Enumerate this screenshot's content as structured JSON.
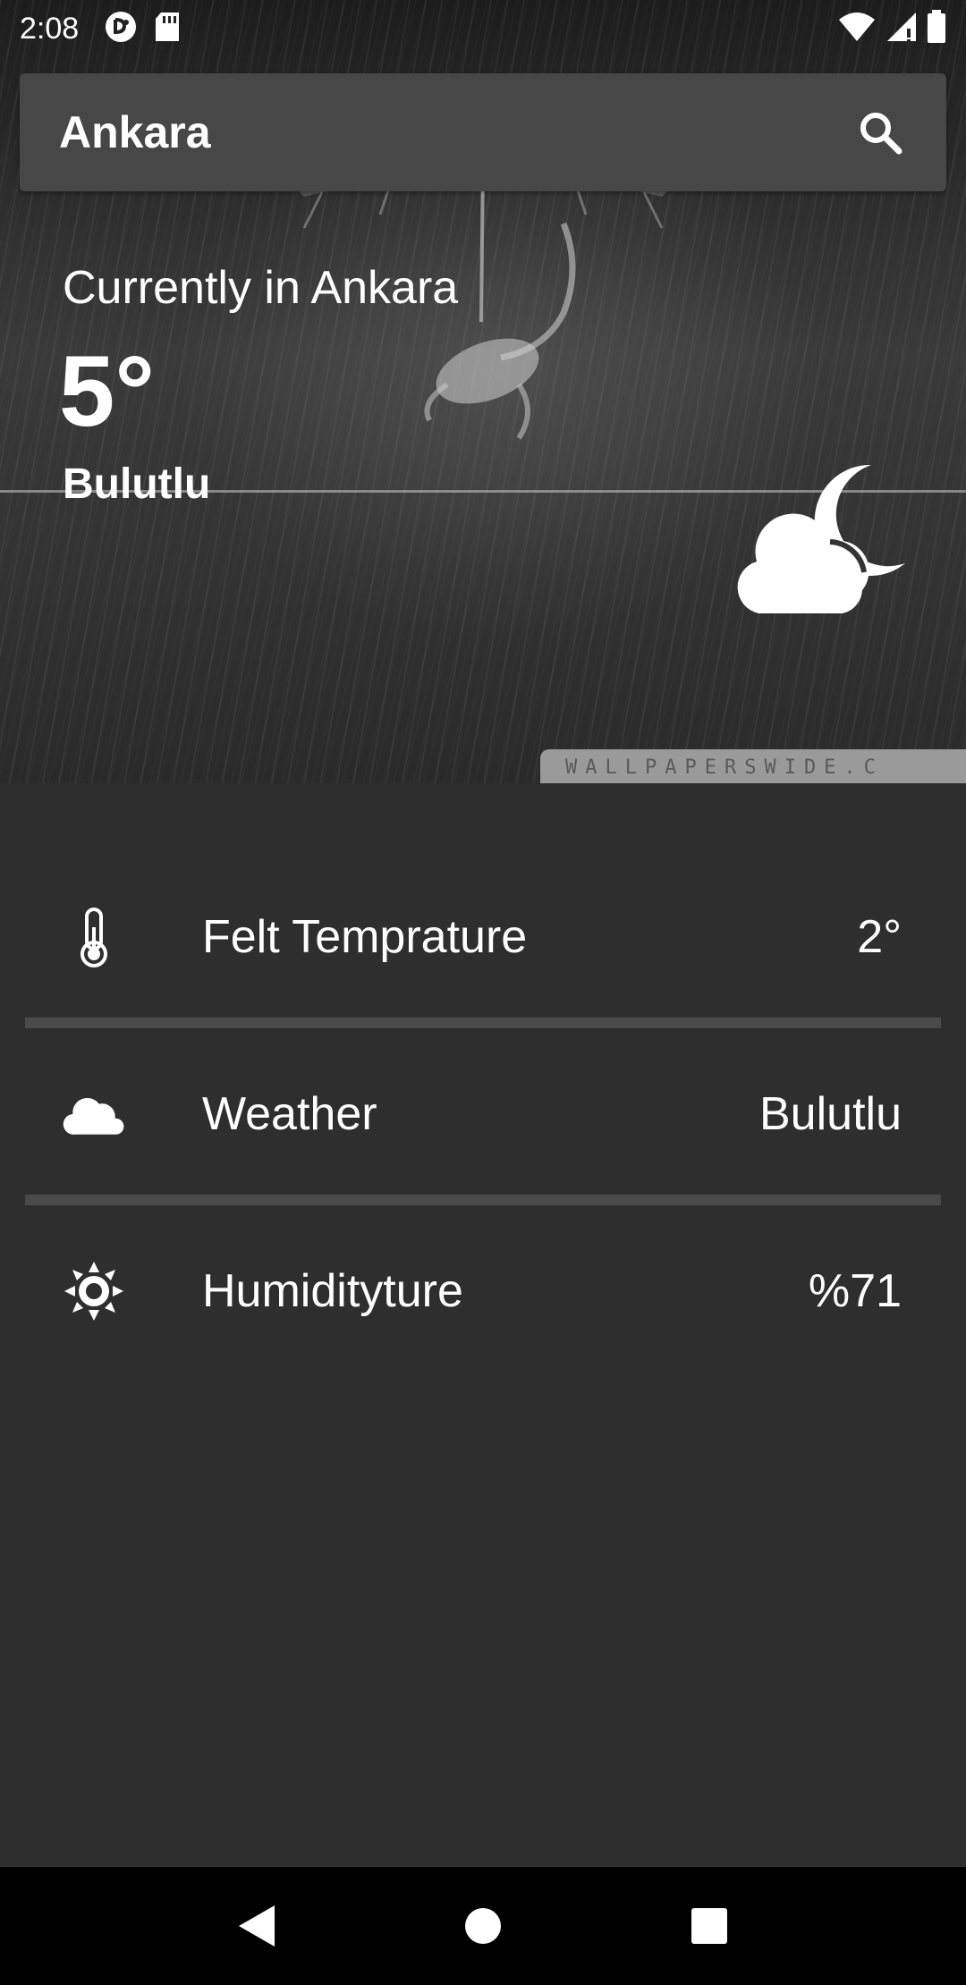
{
  "status_bar": {
    "time": "2:08",
    "icons": [
      "notification-app-icon",
      "sd-card-icon",
      "wifi-icon",
      "signal-icon",
      "battery-icon"
    ]
  },
  "search": {
    "value": "Ankara",
    "icon": "search-icon"
  },
  "current": {
    "label": "Currently in Ankara",
    "temperature": "5°",
    "condition": "Bulutlu",
    "icon": "cloud-moon-icon"
  },
  "background": {
    "watermark": "WALLPAPERSWIDE.C"
  },
  "details": {
    "rows": [
      {
        "icon": "thermometer-icon",
        "label": "Felt Temprature",
        "value": "2°"
      },
      {
        "icon": "cloud-icon",
        "label": "Weather",
        "value": "Bulutlu"
      },
      {
        "icon": "sun-icon",
        "label": "Humidityture",
        "value": "%71"
      }
    ]
  },
  "nav_bar": {
    "buttons": [
      "back-icon",
      "home-icon",
      "recents-icon"
    ]
  },
  "colors": {
    "background": "#2e2e2e",
    "search_bg": "#474747",
    "divider": "#4a4a4a",
    "text": "#ffffff"
  }
}
